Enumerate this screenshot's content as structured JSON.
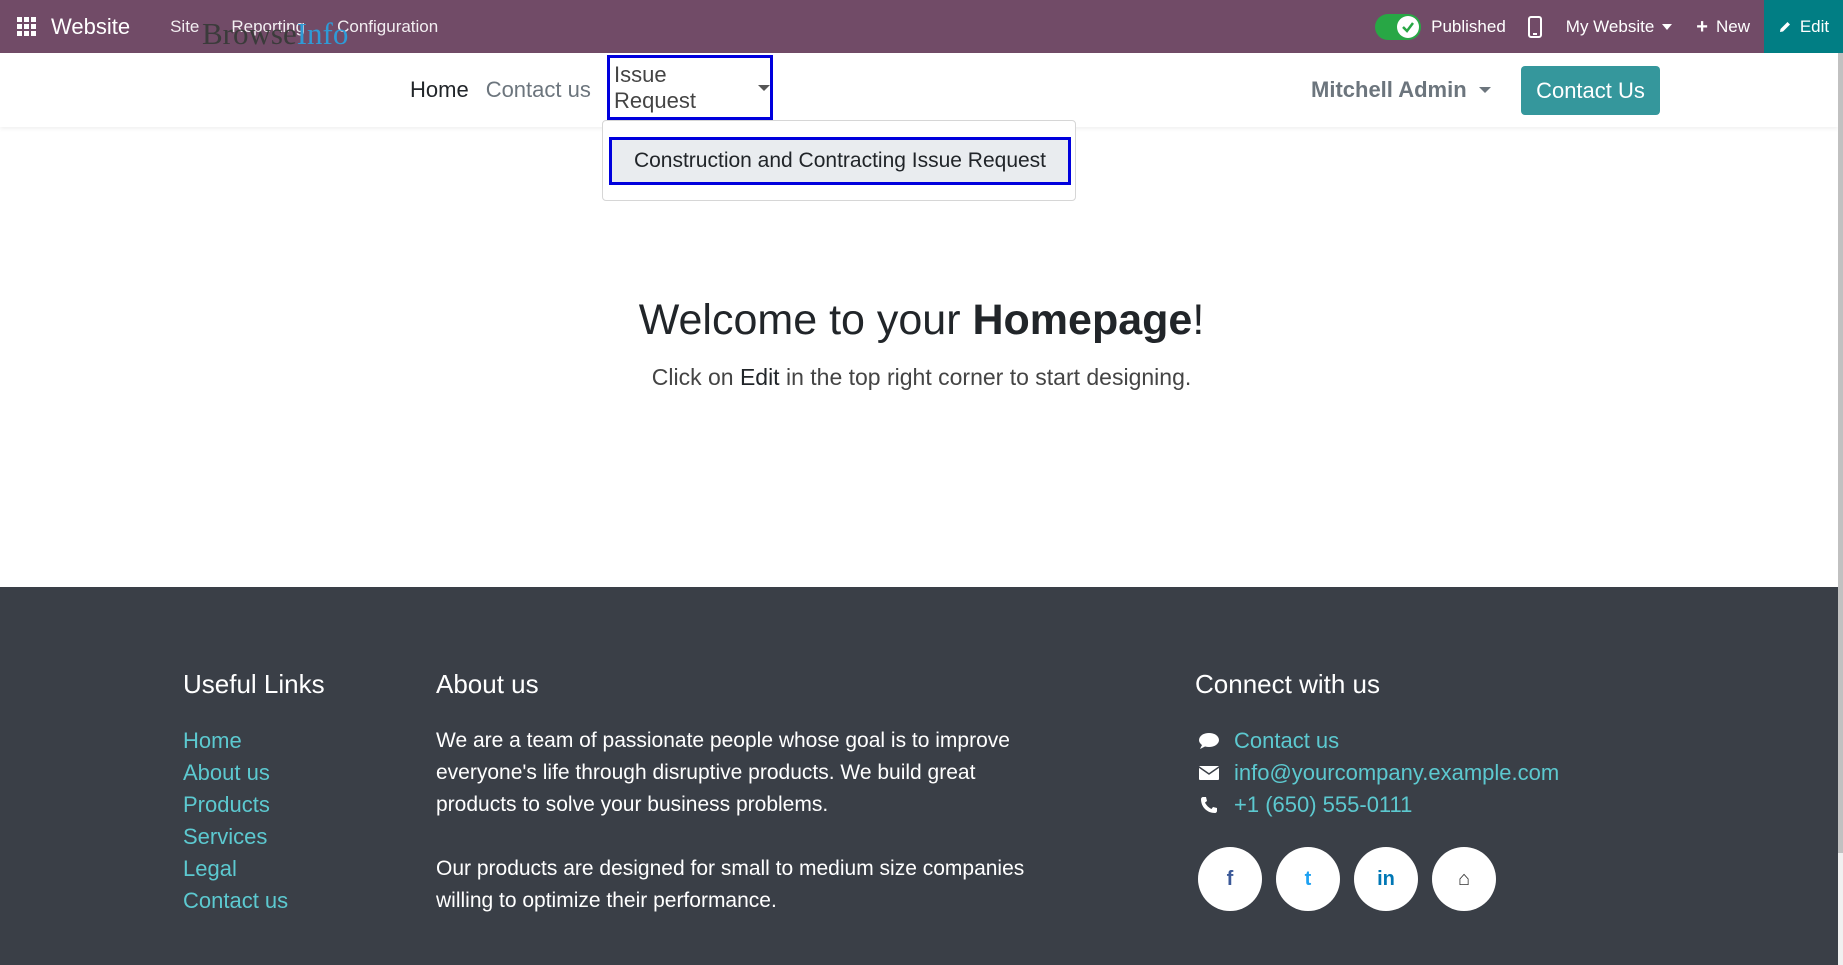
{
  "admin_bar": {
    "app_name": "Website",
    "menu": [
      "Site",
      "Reporting",
      "Configuration"
    ],
    "published_label": "Published",
    "website_selector": "My Website",
    "new_label": "New",
    "edit_label": "Edit",
    "accent_color": "#714b67"
  },
  "header": {
    "logo_part1": "Browse",
    "logo_part2": "Info",
    "nav": [
      "Home",
      "Contact us"
    ],
    "dropdown_label": "Issue Request",
    "dropdown_items": [
      "Construction and Contracting Issue Request"
    ],
    "user": "Mitchell Admin",
    "cta": "Contact Us"
  },
  "main": {
    "welcome_prefix": "Welcome to your ",
    "welcome_bold": "Homepage",
    "welcome_suffix": "!",
    "sub_prefix": "Click on ",
    "sub_bold": "Edit",
    "sub_suffix": " in the top right corner to start designing."
  },
  "footer": {
    "links_title": "Useful Links",
    "links": [
      "Home",
      "About us",
      "Products",
      "Services",
      "Legal",
      "Contact us"
    ],
    "about_title": "About us",
    "about_p1": "We are a team of passionate people whose goal is to improve everyone's life through disruptive products. We build great products to solve your business problems.",
    "about_p2": "Our products are designed for small to medium size companies willing to optimize their performance.",
    "connect_title": "Connect with us",
    "contact_link": "Contact us",
    "email": "info@yourcompany.example.com",
    "phone": "+1 (650) 555-0111",
    "social_icons": [
      "facebook-icon",
      "twitter-icon",
      "linkedin-icon",
      "home-icon"
    ],
    "social_glyphs": [
      "f",
      "t",
      "in",
      "⌂"
    ]
  }
}
